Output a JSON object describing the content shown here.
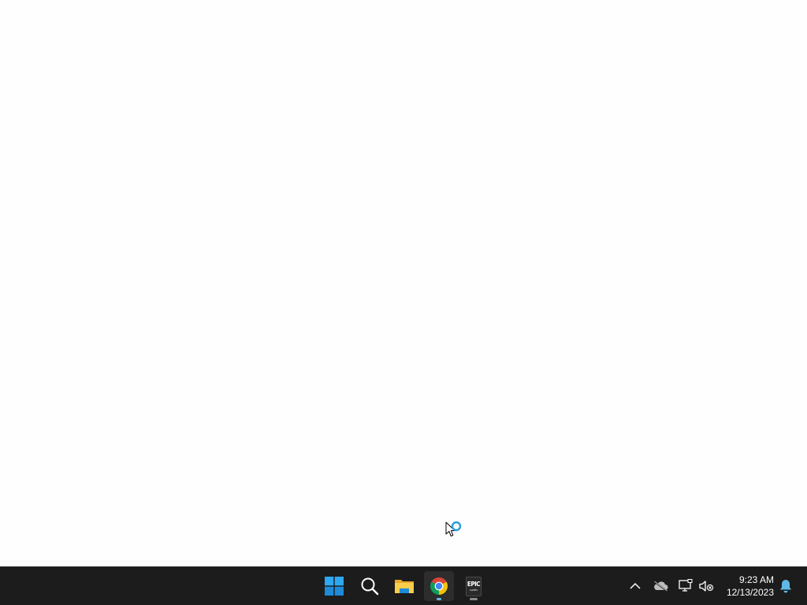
{
  "desktop": {
    "background": "#fefefe"
  },
  "taskbar": {
    "background": "#1c1c1c",
    "apps": [
      {
        "name": "start",
        "icon": "windows-logo-icon",
        "state": "none"
      },
      {
        "name": "search",
        "icon": "search-icon",
        "state": "none"
      },
      {
        "name": "file-explorer",
        "icon": "folder-icon",
        "state": "none"
      },
      {
        "name": "chrome",
        "icon": "chrome-icon",
        "state": "active"
      },
      {
        "name": "epic-games",
        "icon": "epic-games-icon",
        "label": "EPIC",
        "sublabel": "GAMES",
        "state": "open"
      }
    ],
    "tray": {
      "icons": [
        "chevron-up-icon",
        "cloud-offline-icon",
        "network-icon",
        "speaker-muted-icon"
      ],
      "time": "9:23 AM",
      "date": "12/13/2023",
      "notification_icon": "bell-icon"
    },
    "accent": "#60b8e6"
  },
  "cursor": {
    "type": "busy-pointer",
    "icon": "busy-cursor-icon"
  }
}
